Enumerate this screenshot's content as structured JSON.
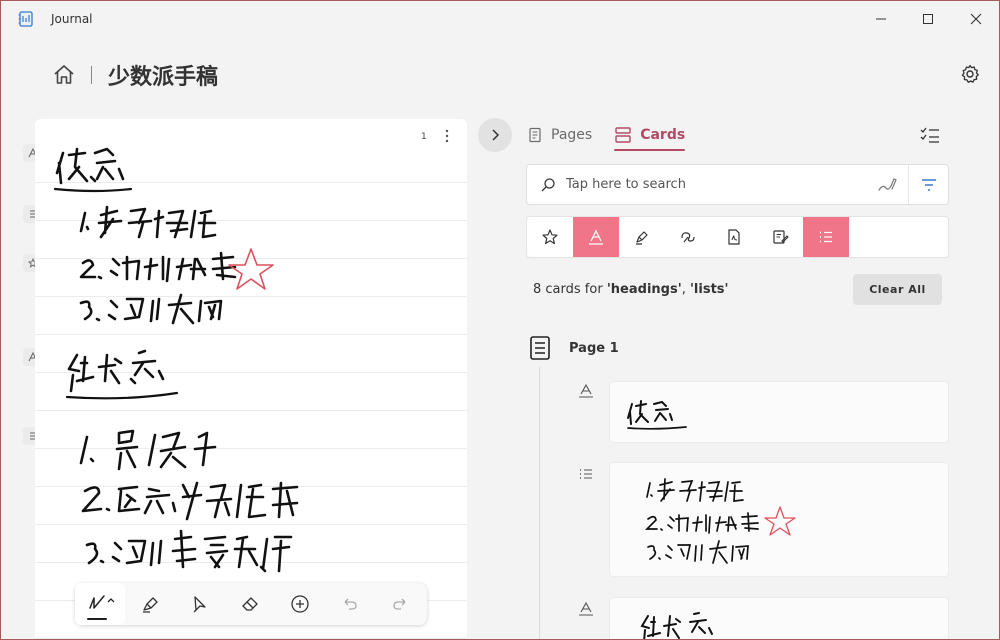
{
  "window": {
    "title": "Journal",
    "icons": {
      "app": "journal-app-icon",
      "minimize": "minimize-icon",
      "maximize": "maximize-icon",
      "close": "close-icon"
    }
  },
  "header": {
    "title": "少数派手稿",
    "icons": {
      "home": "home-icon",
      "settings": "gear-icon"
    }
  },
  "canvas": {
    "page_number": "1",
    "tags": [
      {
        "icon": "heading-tag-icon"
      },
      {
        "icon": "list-tag-icon"
      },
      {
        "icon": "star-tag-icon"
      },
      {
        "icon": "heading-tag-icon"
      },
      {
        "icon": "list-tag-icon"
      }
    ],
    "pen_toolbar": [
      {
        "name": "pen-tool",
        "icon": "pen-icon",
        "active": true
      },
      {
        "name": "highlighter-tool",
        "icon": "highlighter-icon"
      },
      {
        "name": "lasso-tool",
        "icon": "lasso-select-icon"
      },
      {
        "name": "eraser-tool",
        "icon": "eraser-icon"
      },
      {
        "name": "add-tool",
        "icon": "add-circle-icon"
      },
      {
        "name": "undo-button",
        "icon": "undo-icon"
      },
      {
        "name": "redo-button",
        "icon": "redo-icon"
      }
    ]
  },
  "panel": {
    "tabs": [
      {
        "label": "Pages",
        "icon": "pages-icon",
        "active": false
      },
      {
        "label": "Cards",
        "icon": "cards-icon",
        "active": true
      }
    ],
    "search": {
      "placeholder": "Tap here to search",
      "icons": [
        "search-icon",
        "ink-search-icon",
        "filter-icon"
      ]
    },
    "filters": [
      {
        "name": "favorites",
        "icon": "star-icon",
        "on": false
      },
      {
        "name": "headings",
        "icon": "heading-icon",
        "on": true
      },
      {
        "name": "highlights",
        "icon": "highlighter-icon",
        "on": false
      },
      {
        "name": "drawings",
        "icon": "drawing-icon",
        "on": false
      },
      {
        "name": "pdf",
        "icon": "pdf-icon",
        "on": false
      },
      {
        "name": "notes",
        "icon": "note-edit-icon",
        "on": false
      },
      {
        "name": "lists",
        "icon": "list-icon",
        "on": true
      }
    ],
    "results": {
      "prefix": "8 cards for ",
      "q1": "'headings'",
      "sep": ", ",
      "q2": "'lists'"
    },
    "clear_label": "Clear All",
    "group": {
      "label": "Page 1",
      "icon": "page-icon"
    },
    "cards": [
      {
        "type_icon": "heading-icon"
      },
      {
        "type_icon": "list-icon"
      },
      {
        "type_icon": "heading-icon"
      }
    ]
  },
  "colors": {
    "accent": "#b34a63",
    "filter_on": "#f07589",
    "star": "#e0505e"
  }
}
